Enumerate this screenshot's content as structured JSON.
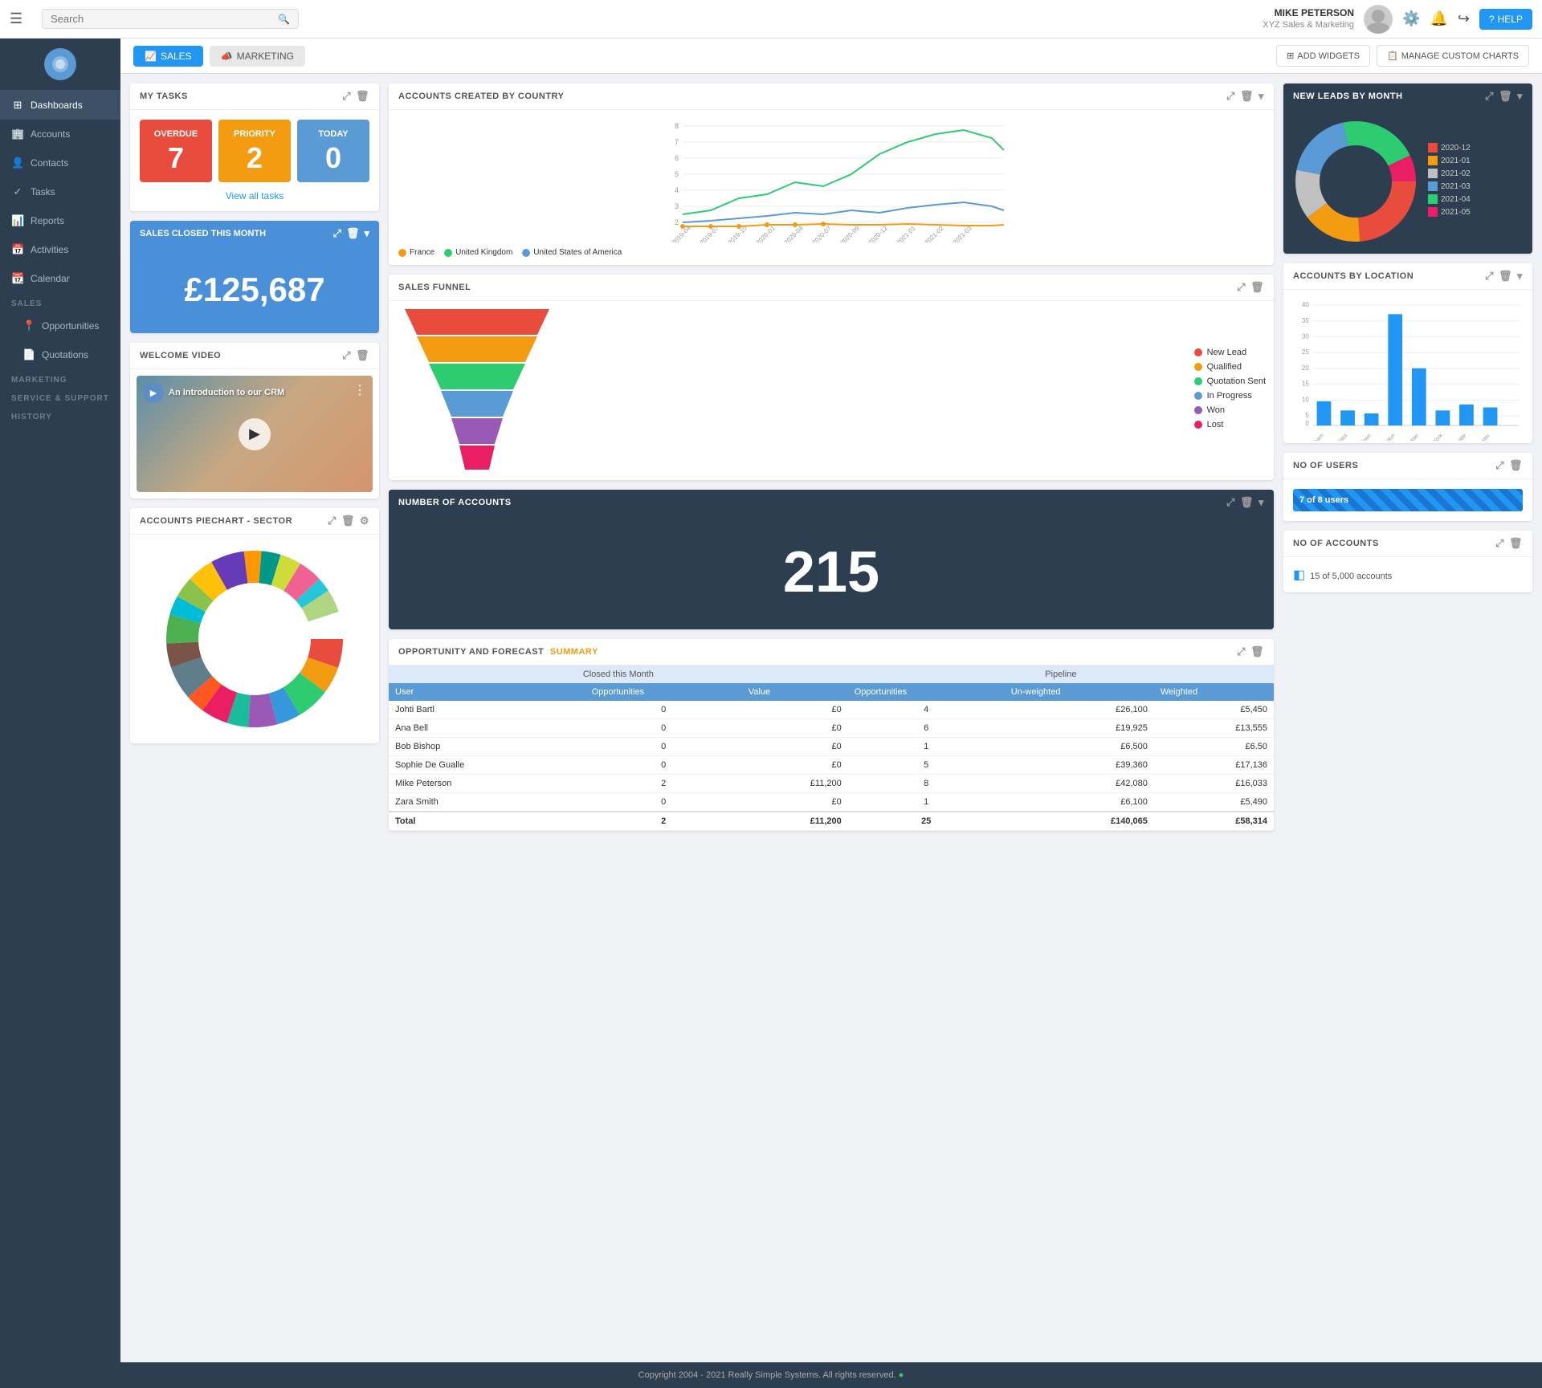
{
  "topNav": {
    "hamburger": "☰",
    "search": {
      "placeholder": "Search"
    },
    "user": {
      "name": "MIKE PETERSON",
      "company": "XYZ Sales & Marketing"
    },
    "helpLabel": "HELP"
  },
  "sidebar": {
    "logo": "◉",
    "items": [
      {
        "id": "dashboards",
        "label": "Dashboards",
        "icon": "⊞",
        "active": true
      },
      {
        "id": "accounts",
        "label": "Accounts",
        "icon": "🏢"
      },
      {
        "id": "contacts",
        "label": "Contacts",
        "icon": "👤"
      },
      {
        "id": "tasks",
        "label": "Tasks",
        "icon": "✓"
      },
      {
        "id": "reports",
        "label": "Reports",
        "icon": "📊"
      },
      {
        "id": "activities",
        "label": "Activities",
        "icon": "📅"
      },
      {
        "id": "calendar",
        "label": "Calendar",
        "icon": "📆"
      }
    ],
    "sections": [
      {
        "id": "sales",
        "label": "SALES",
        "items": [
          {
            "id": "opportunities",
            "label": "Opportunities",
            "icon": "📍"
          },
          {
            "id": "quotations",
            "label": "Quotations",
            "icon": "📄"
          }
        ]
      },
      {
        "id": "marketing",
        "label": "MARKETING",
        "items": []
      },
      {
        "id": "service",
        "label": "SERVICE & SUPPORT",
        "items": []
      },
      {
        "id": "history",
        "label": "HISTORY",
        "items": []
      }
    ]
  },
  "toolbar": {
    "salesTab": "SALES",
    "marketingTab": "MARKETING",
    "addWidgets": "ADD WIDGETS",
    "manageCharts": "MANAGE CUSTOM CHARTS"
  },
  "myTasks": {
    "title": "MY TASKS",
    "overdue": {
      "label": "OVERDUE",
      "value": 7
    },
    "priority": {
      "label": "PRIORITY",
      "value": 2
    },
    "today": {
      "label": "TODAY",
      "value": 0
    },
    "viewAll": "View all tasks"
  },
  "salesClosed": {
    "title": "SALES CLOSED THIS MONTH",
    "amount": "£125,687"
  },
  "accountsByCountry": {
    "title": "ACCOUNTS CREATED BY COUNTRY",
    "legend": [
      {
        "label": "France",
        "color": "#f39c12"
      },
      {
        "label": "United Kingdom",
        "color": "#2ecc71"
      },
      {
        "label": "United States of America",
        "color": "#5b9bd5"
      }
    ]
  },
  "salesFunnel": {
    "title": "SALES FUNNEL",
    "legend": [
      {
        "label": "New Lead",
        "color": "#e74c3c"
      },
      {
        "label": "Qualified",
        "color": "#f39c12"
      },
      {
        "label": "Quotation Sent",
        "color": "#2ecc71"
      },
      {
        "label": "In Progress",
        "color": "#5b9bd5"
      },
      {
        "label": "Won",
        "color": "#8e44ad"
      },
      {
        "label": "Lost",
        "color": "#e91e8c"
      }
    ]
  },
  "numberOfAccounts": {
    "title": "NUMBER OF ACCOUNTS",
    "value": "215"
  },
  "newLeads": {
    "title": "NEW LEADS BY MONTH",
    "legend": [
      {
        "label": "2020-12",
        "color": "#e74c3c"
      },
      {
        "label": "2021-01",
        "color": "#f39c12"
      },
      {
        "label": "2021-02",
        "color": "#e8e8e8"
      },
      {
        "label": "2021-03",
        "color": "#5b9bd5"
      },
      {
        "label": "2021-04",
        "color": "#2ecc71"
      },
      {
        "label": "2021-05",
        "color": "#e91e8c"
      }
    ]
  },
  "accountsByLocation": {
    "title": "ACCOUNTS BY LOCATION",
    "bars": [
      {
        "label": "Birmingham",
        "value": 8
      },
      {
        "label": "Bristol",
        "value": 5
      },
      {
        "label": "Cape Town",
        "value": 4
      },
      {
        "label": "London",
        "value": 37
      },
      {
        "label": "Manchester",
        "value": 19
      },
      {
        "label": "New York",
        "value": 5
      },
      {
        "label": "Newcastle",
        "value": 7
      },
      {
        "label": "Winchester",
        "value": 6
      }
    ],
    "maxValue": 40,
    "color": "#2196f3"
  },
  "noOfUsers": {
    "title": "NO OF USERS",
    "barText": "7 of 8 users",
    "barWidth": "87.5%"
  },
  "noOfAccounts": {
    "title": "NO OF ACCOUNTS",
    "text": "15 of 5,000 accounts",
    "progressWidth": "0.3%"
  },
  "welcomeVideo": {
    "title": "WELCOME VIDEO",
    "overlayText": "An Introduction to our CRM"
  },
  "accountsPiechart": {
    "title": "ACCOUNTS PIECHART - SECTOR"
  },
  "oppForecast": {
    "title": "OPPORTUNITY AND FORECAST",
    "titleAccent": "SUMMARY",
    "columns": {
      "closedThisMonth": "Closed this Month",
      "pipeline": "Pipeline",
      "user": "User",
      "opportunities": "Opportunities",
      "value": "Value",
      "unweighted": "Un-weighted",
      "weighted": "Weighted"
    },
    "rows": [
      {
        "user": "Johti Bartl",
        "closedOpp": 0,
        "closedVal": "£0",
        "pipeOpp": 4,
        "unweighted": "£26,100",
        "weighted": "£5,450"
      },
      {
        "user": "Ana Bell",
        "closedOpp": 0,
        "closedVal": "£0",
        "pipeOpp": 6,
        "unweighted": "£19,925",
        "weighted": "£13,555"
      },
      {
        "user": "Bob Bishop",
        "closedOpp": 0,
        "closedVal": "£0",
        "pipeOpp": 1,
        "unweighted": "£6,500",
        "weighted": "£6.50"
      },
      {
        "user": "Sophie De Gualle",
        "closedOpp": 0,
        "closedVal": "£0",
        "pipeOpp": 5,
        "unweighted": "£39,360",
        "weighted": "£17,136"
      },
      {
        "user": "Mike Peterson",
        "closedOpp": 2,
        "closedVal": "£11,200",
        "pipeOpp": 8,
        "unweighted": "£42,080",
        "weighted": "£16,033"
      },
      {
        "user": "Zara Smith",
        "closedOpp": 0,
        "closedVal": "£0",
        "pipeOpp": 1,
        "unweighted": "£6,100",
        "weighted": "£5,490"
      }
    ],
    "total": {
      "label": "Total",
      "closedOpp": 2,
      "closedVal": "£11,200",
      "pipeOpp": 25,
      "unweighted": "£140,065",
      "weighted": "£58,314"
    }
  },
  "footer": {
    "text": "Copyright 2004 - 2021 Really Simple Systems. All rights reserved.",
    "dot": "●"
  }
}
